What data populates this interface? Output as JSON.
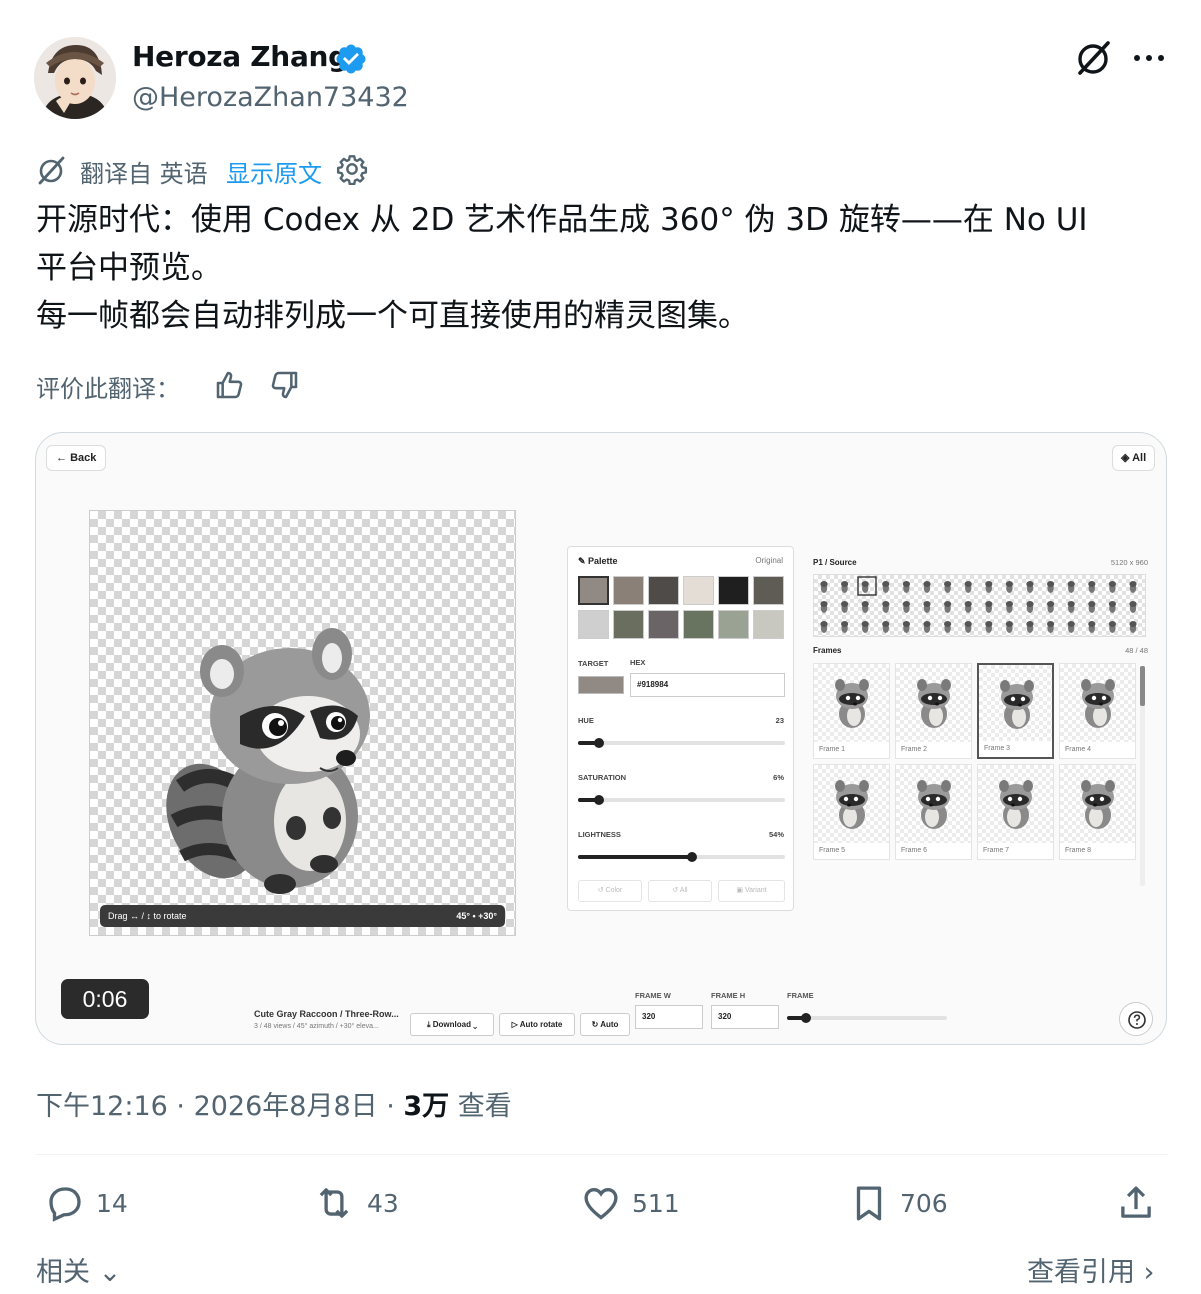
{
  "author": {
    "name": "Heroza Zhang",
    "handle": "@HerozaZhan73432",
    "verified_color": "#1d9bf0"
  },
  "header_icons": {
    "grok": "grok-icon",
    "more": "more-icon"
  },
  "translation": {
    "from_label": "翻译自 英语",
    "show_original": "显示原文",
    "link_color": "#1d9bf0"
  },
  "tweet": {
    "lines": [
      "开源时代：使用 Codex 从 2D 艺术作品生成 360° 伪 3D 旋转——在 No UI",
      "平台中预览。",
      "每一帧都会自动排列成一个可直接使用的精灵图集。"
    ]
  },
  "rate": {
    "label": "评价此翻译："
  },
  "media": {
    "back_label": "Back",
    "all_label": "All",
    "drag_hint": "Drag ↔ / ↕ to rotate",
    "angle": "45° • +30°",
    "time": "0:06",
    "palette": {
      "title": "Palette",
      "original": "Original",
      "swatches": [
        "#918984",
        "#8a8078",
        "#4e4b48",
        "#e3ddd6",
        "#1f1f1f",
        "#5e5c54",
        "#cfcfcf",
        "#6a6e5e",
        "#6b6466",
        "#68745f",
        "#9aa293",
        "#c8c8c0"
      ],
      "target_label": "TARGET",
      "hex_label": "HEX",
      "target_color": "#918984",
      "hex_value": "#918984",
      "hue_label": "HUE",
      "hue_value": "23",
      "hue": 23,
      "saturation_label": "SATURATION",
      "saturation_value": "6%",
      "saturation": 6,
      "lightness_label": "LIGHTNESS",
      "lightness_value": "54%",
      "lightness": 54,
      "btn_color": "Color",
      "btn_all": "All",
      "btn_variant": "Variant"
    },
    "source": {
      "title": "P1 / Source",
      "size": "5120 x 960",
      "frames_label": "Frames",
      "frames_count": "48 / 48",
      "frames": [
        "Frame 1",
        "Frame 2",
        "Frame 3",
        "Frame 4",
        "Frame 5",
        "Frame 6",
        "Frame 7",
        "Frame 8"
      ]
    },
    "toolbar": {
      "title": "Cute Gray Raccoon / Three-Row...",
      "subtitle": "3 / 48 views / 45° azimuth / +30° eleva...",
      "download": "Download",
      "auto_rotate": "Auto rotate",
      "auto": "Auto",
      "frame_w_label": "FRAME W",
      "frame_w": "320",
      "frame_h_label": "FRAME H",
      "frame_h": "320",
      "frame_label": "FRAME"
    }
  },
  "meta": {
    "time": "下午12:16",
    "date": "2026年8月8日",
    "views_count": "3万",
    "views_label": "查看"
  },
  "actions": {
    "replies": "14",
    "retweets": "43",
    "likes": "511",
    "bookmarks": "706"
  },
  "footer": {
    "related": "相关",
    "quotes": "查看引用"
  }
}
